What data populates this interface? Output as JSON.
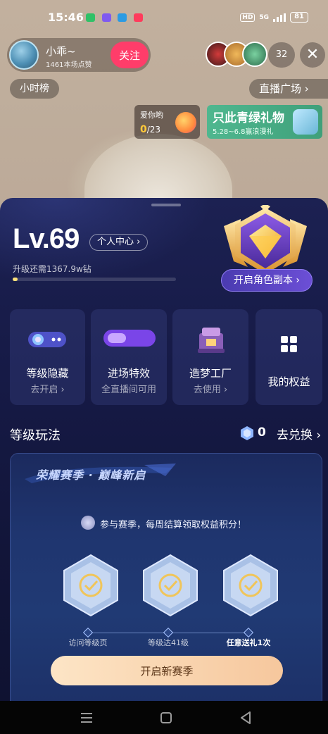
{
  "status_bar": {
    "time": "15:46",
    "hd": "HD",
    "network": "5G",
    "battery": "81"
  },
  "host": {
    "name": "小乖~",
    "likes": "1461本场点赞",
    "follow_label": "关注"
  },
  "viewers": {
    "count": "32",
    "close_icon": "close-icon"
  },
  "top_nav": {
    "hour_rank": "小时榜",
    "plaza": "直播广场 ›"
  },
  "event_a": {
    "label": "爱你哟",
    "progress_current": "0",
    "progress_total": "/23"
  },
  "event_b": {
    "title": "只此青绿礼物",
    "subtitle": "5.28~6.8赢浪漫礼"
  },
  "level": {
    "level_text": "Lv.69",
    "personal_center": "个人中心 ›",
    "upgrade_text": "升级还需1367.9w钻",
    "progress": 0.03,
    "role_copy_button": "开启角色副本 ›"
  },
  "features": [
    {
      "label": "等级隐藏",
      "sub": "去开启 ›",
      "icon": "hide-toggle-icon"
    },
    {
      "label": "进场特效",
      "sub": "全直播间可用",
      "icon": "entrance-effect-icon"
    },
    {
      "label": "造梦工厂",
      "sub": "去使用 ›",
      "icon": "dream-factory-icon"
    },
    {
      "label": "我的权益",
      "sub": "",
      "icon": "grid-icon"
    }
  ],
  "gameplay": {
    "title": "等级玩法",
    "gem_count": "0",
    "redeem_label": "去兑换 ›"
  },
  "season": {
    "title": "荣耀赛季 · 巅峰新启",
    "tip": "参与赛季，每周结算领取权益积分！",
    "steps": [
      "访问等级页",
      "等级达41级",
      "任意送礼1次"
    ],
    "start_button": "开启新赛季"
  },
  "colors": {
    "accent_follow": "#ff3d6a",
    "sheet_bg": "#161a46",
    "gold": "#ffe27a",
    "season_button": "#f6c79d"
  }
}
